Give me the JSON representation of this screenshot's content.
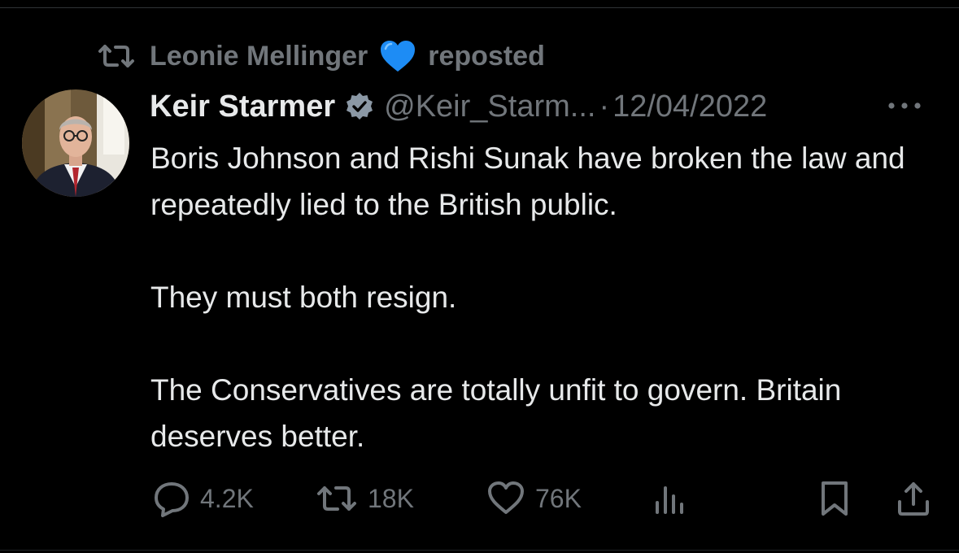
{
  "repost": {
    "user": "Leonie Mellinger",
    "emoji": "blue-heart-emoji",
    "label": "reposted"
  },
  "tweet": {
    "author_name": "Keir Starmer",
    "verified": true,
    "handle": "@Keir_Starm...",
    "separator": "·",
    "date": "12/04/2022",
    "paragraphs": [
      "Boris Johnson and Rishi Sunak have broken the law and repeatedly lied to the British public.",
      "They must both resign.",
      "The Conservatives are totally unfit to govern. Britain deserves better."
    ]
  },
  "actions": {
    "replies": "4.2K",
    "reposts": "18K",
    "likes": "76K"
  },
  "icons": {
    "repost": "repost-icon",
    "verified": "verified-badge-icon",
    "more": "more-options-icon",
    "reply": "reply-icon",
    "like": "heart-icon",
    "views": "analytics-icon",
    "bookmark": "bookmark-icon",
    "share": "share-icon"
  },
  "colors": {
    "background": "#000000",
    "text": "#e7e9ea",
    "muted": "#71767b",
    "emoji_blue": "#1d8cf5"
  }
}
